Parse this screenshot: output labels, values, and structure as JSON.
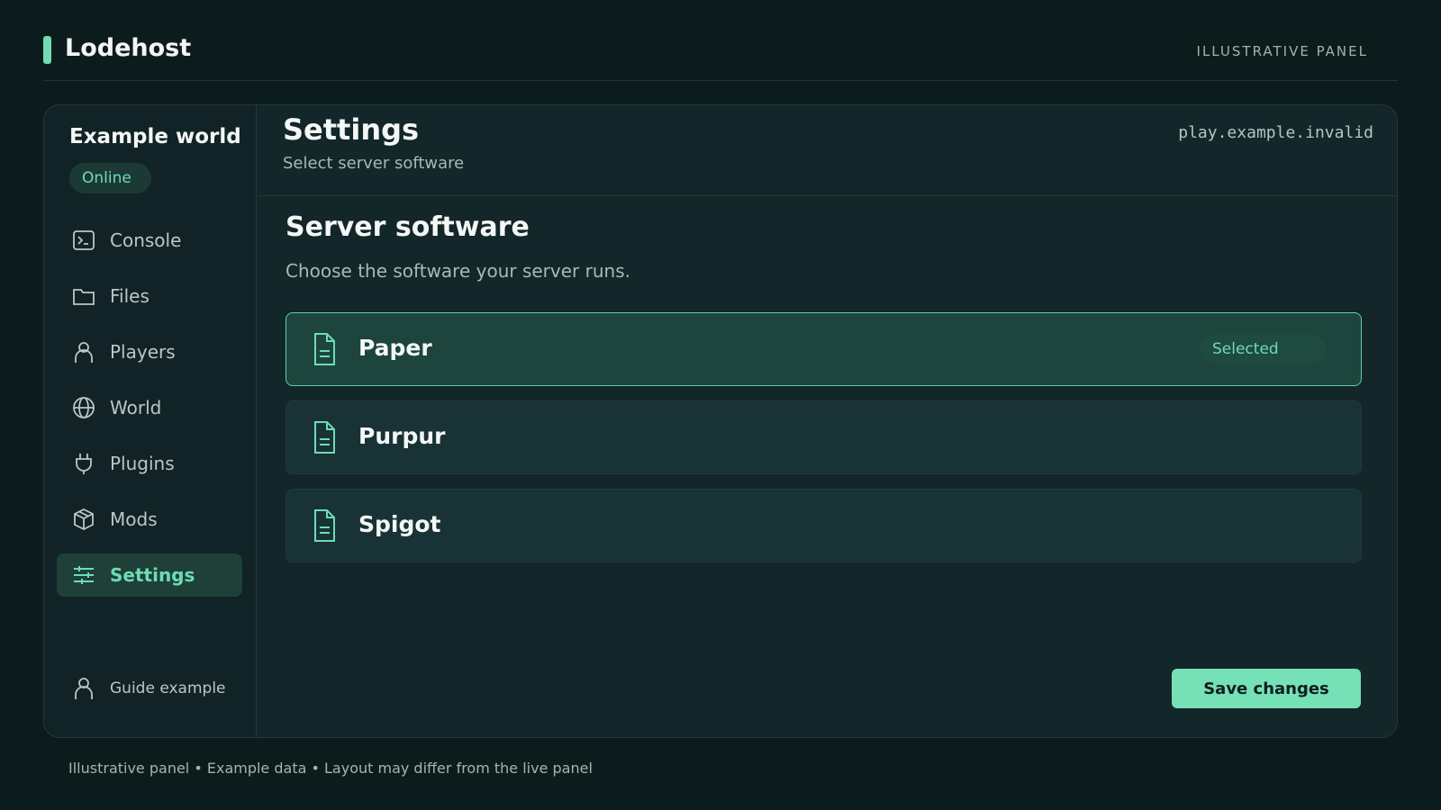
{
  "app": {
    "brand": "Lodehost",
    "tag": "ILLUSTRATIVE PANEL",
    "accent_color": "#6fdcb2"
  },
  "sidebar": {
    "world_name": "Example world",
    "status": "Online",
    "items": [
      {
        "label": "Console",
        "icon": "terminal-icon"
      },
      {
        "label": "Files",
        "icon": "folder-icon"
      },
      {
        "label": "Players",
        "icon": "user-icon"
      },
      {
        "label": "World",
        "icon": "globe-icon"
      },
      {
        "label": "Plugins",
        "icon": "plug-icon"
      },
      {
        "label": "Mods",
        "icon": "box-icon"
      },
      {
        "label": "Settings",
        "icon": "sliders-icon",
        "active": true
      }
    ],
    "user": "Guide example"
  },
  "header": {
    "title": "Settings",
    "subtitle": "Select server software",
    "address": "play.example.invalid"
  },
  "section": {
    "title": "Server software",
    "description": "Choose the software your server runs.",
    "options": [
      {
        "label": "Paper",
        "badge": "Selected",
        "selected": true,
        "icon": "document-icon"
      },
      {
        "label": "Purpur",
        "selected": false,
        "icon": "document-icon"
      },
      {
        "label": "Spigot",
        "selected": false,
        "icon": "document-icon"
      }
    ]
  },
  "actions": {
    "save_label": "Save changes"
  },
  "footer": {
    "note": "Illustrative panel • Example data • Layout may differ from the live panel"
  }
}
